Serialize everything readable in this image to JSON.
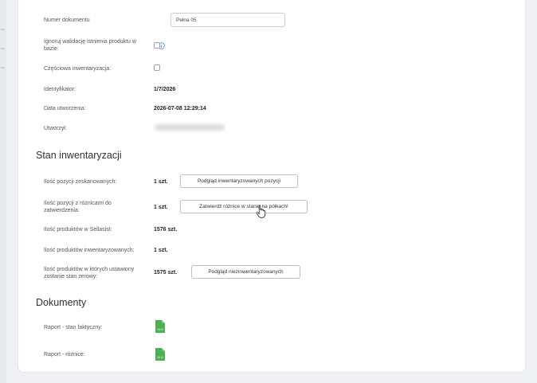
{
  "form": {
    "doc_number_label": "Numer dokumentu",
    "doc_number_value": "Pełna 05",
    "ignore_validation_label": "Ignoruj walidację istnienia produktu w bazie:",
    "partial_inventory_label": "Częściowa inwentaryzacja:",
    "identifier_label": "Identyfikator:",
    "identifier_value": "1/7/2026",
    "created_date_label": "Data utworzenia:",
    "created_date_value": "2026-07-08 12:29:14",
    "created_by_label": "Utworzył:"
  },
  "inventory_status": {
    "title": "Stan inwentaryzacji",
    "scanned_label": "Ilość pozycji zeskanowanych:",
    "scanned_value": "1 szt.",
    "scanned_button": "Podgląd inwentaryzowanych pozycji",
    "diff_label": "Ilość pozycji z różnicami do zatwierdzenia:",
    "diff_value": "1 szt.",
    "diff_button": "Zatwierdź różnice w stanie na półkach!",
    "products_total_label": "Ilość produktów w Sellasist:",
    "products_total_value": "1576 szt.",
    "products_inventoried_label": "Ilość produktów inwentaryzowanych:",
    "products_inventoried_value": "1 szt.",
    "zero_stock_label": "Ilość produktów w których ustawiony zostanie stan zerowy:",
    "zero_stock_value": "1575 szt.",
    "zero_stock_button": "Podgląd niezinwentaryzowanych"
  },
  "documents": {
    "title": "Dokumenty",
    "report_actual_label": "Raport - stan faktyczny:",
    "report_diff_label": "Raport - różnice:",
    "file_icon_text": "XLS"
  },
  "colors": {
    "info_icon": "#3b82c4",
    "file_icon": "#4caf50"
  },
  "icons": {
    "info": "info-icon",
    "excel_file": "excel-file-icon",
    "cursor": "hand-pointer-icon"
  }
}
